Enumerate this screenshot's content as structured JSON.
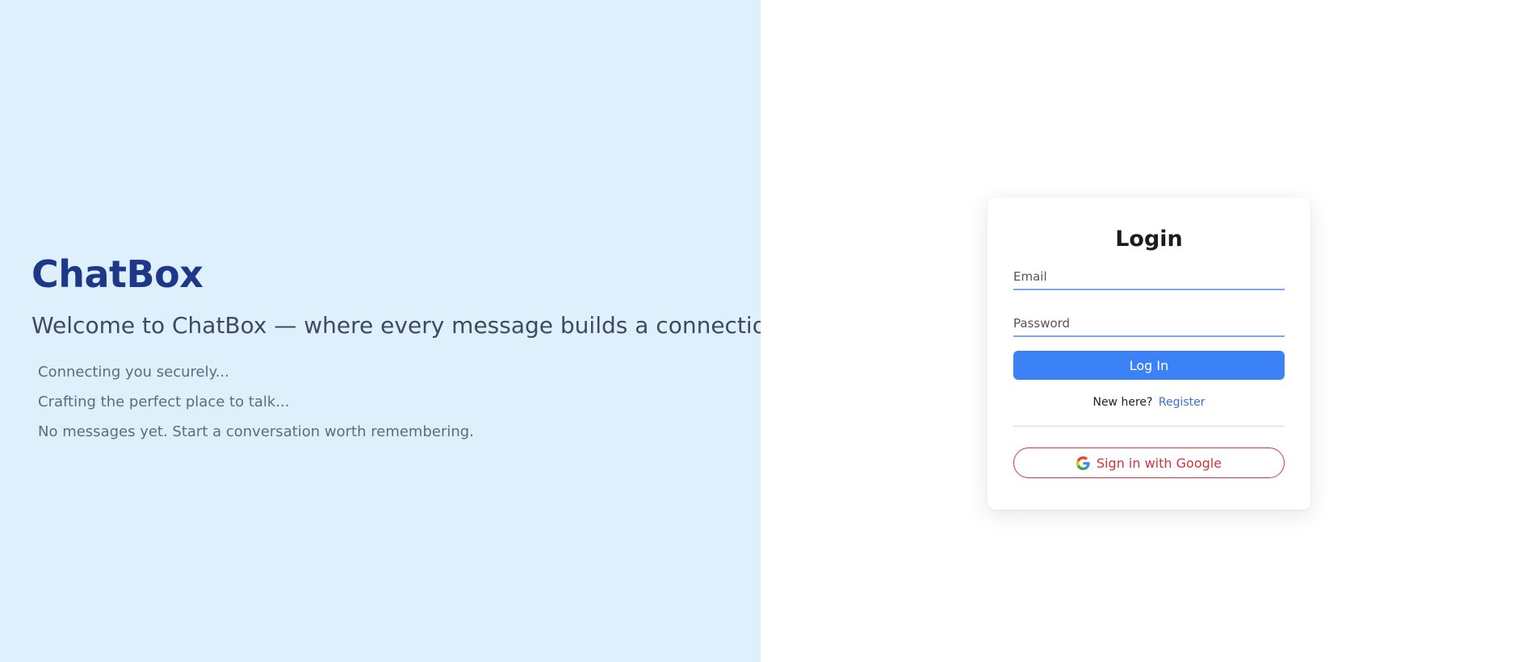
{
  "brand": {
    "name": "ChatBox",
    "tagline": "Welcome to ChatBox — where every message builds a connection."
  },
  "status_messages": [
    "Connecting you securely...",
    "Crafting the perfect place to talk...",
    "No messages yet. Start a conversation worth remembering."
  ],
  "login": {
    "title": "Login",
    "email_placeholder": "Email",
    "email_value": "",
    "password_placeholder": "Password",
    "password_value": "",
    "submit_label": "Log In",
    "register_prompt": "New here?",
    "register_link": "Register",
    "google_label": "Sign in with Google"
  },
  "colors": {
    "left_panel_bg": "#dff0fd",
    "brand_color": "#1d3889",
    "primary_button": "#3b82f6",
    "google_accent": "#dc3545",
    "link_color": "#3b6fd6"
  },
  "icons": {
    "google": "google-g-icon"
  }
}
